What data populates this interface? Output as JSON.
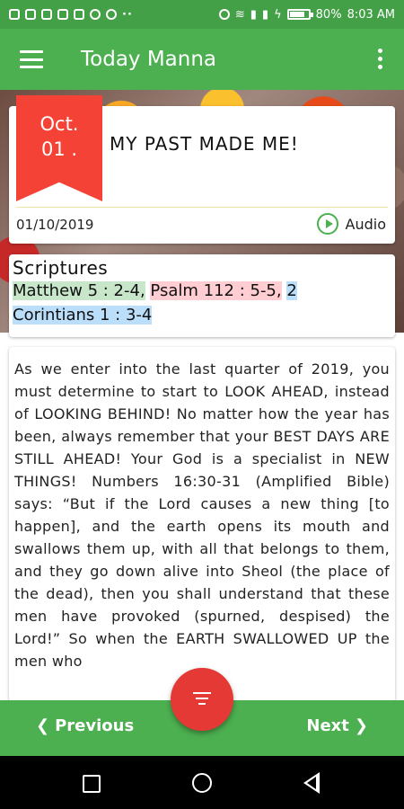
{
  "status_bar": {
    "battery": "80%",
    "time": "8:03 AM",
    "battery_level": 0.8
  },
  "app_bar": {
    "title": "Today Manna"
  },
  "date_card": {
    "month": "Oct.",
    "day": "01 .",
    "title": "MY PAST MADE ME!",
    "date": "01/10/2019",
    "audio_label": "Audio"
  },
  "scriptures": {
    "heading": "Scriptures",
    "ref1": "Matthew 5 : 2-4,",
    "ref2": "Psalm 112 : 5-5,",
    "ref3a": "2",
    "ref3b": "Corintians 1 : 3-4"
  },
  "body": {
    "text": "As we enter into the last quarter of 2019, you must determine to start to LOOK AHEAD, instead of LOOKING BEHIND! No matter how the year has been, always remember that your BEST DAYS ARE STILL AHEAD! Your God is a specialist in NEW THINGS! Numbers 16:30-31 (Amplified Bible) says: “But if the Lord causes a new thing [to happen], and the earth opens its mouth and swallows them up, with all that belongs to them, and they go down alive into Sheol (the place of the dead), then you shall understand that these men have provoked (spurned, despised) the Lord!” So when the EARTH SWALLOWED UP the men who"
  },
  "nav": {
    "previous": "Previous",
    "next": "Next"
  },
  "colors": {
    "primary": "#4caf50",
    "accent": "#f44336",
    "fab": "#e53935"
  }
}
